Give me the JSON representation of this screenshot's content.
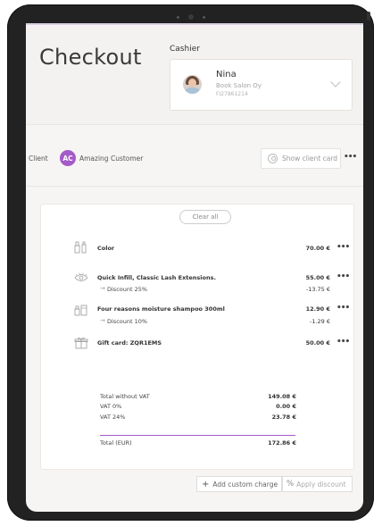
{
  "header": {
    "title": "Checkout",
    "cashier_label": "Cashier",
    "cashier": {
      "name": "Nina",
      "company": "Book Salon Oy",
      "id": "FI27861214"
    }
  },
  "client": {
    "label": "Client",
    "initials": "AC",
    "name": "Amazing Customer",
    "show_card_label": "Show client card",
    "more": "•••"
  },
  "cart": {
    "clear_label": "Clear all",
    "items": [
      {
        "icon": "cosmetics-icon",
        "name": "Color",
        "price": "70.00 €",
        "more": "•••"
      },
      {
        "icon": "eye-icon",
        "name": "Quick Infill, Classic Lash Extensions.",
        "price": "55.00 €",
        "more": "•••",
        "discount": {
          "arrow": "→",
          "label": "Discount 25%",
          "price": "-13.75 €"
        }
      },
      {
        "icon": "products-icon",
        "name": "Four reasons moisture shampoo 300ml",
        "price": "12.90 €",
        "more": "•••",
        "discount": {
          "arrow": "→",
          "label": "Discount 10%",
          "price": "-1.29 €"
        }
      },
      {
        "icon": "gift-icon",
        "name": "Gift card: ZQR1EMS",
        "price": "50.00 €",
        "more": "•••"
      }
    ],
    "totals": {
      "without_vat_label": "Total without VAT",
      "without_vat": "149.08 €",
      "vat0_label": "VAT 0%",
      "vat0": "0.00 €",
      "vat24_label": "VAT 24%",
      "vat24": "23.78 €",
      "total_label": "Total (EUR)",
      "total": "172.86 €"
    }
  },
  "footer": {
    "add_charge_icon": "+",
    "add_charge_label": "Add custom charge",
    "apply_discount_icon": "%",
    "apply_discount_label": "Apply discount"
  },
  "colors": {
    "accent": "#a45ac8"
  }
}
